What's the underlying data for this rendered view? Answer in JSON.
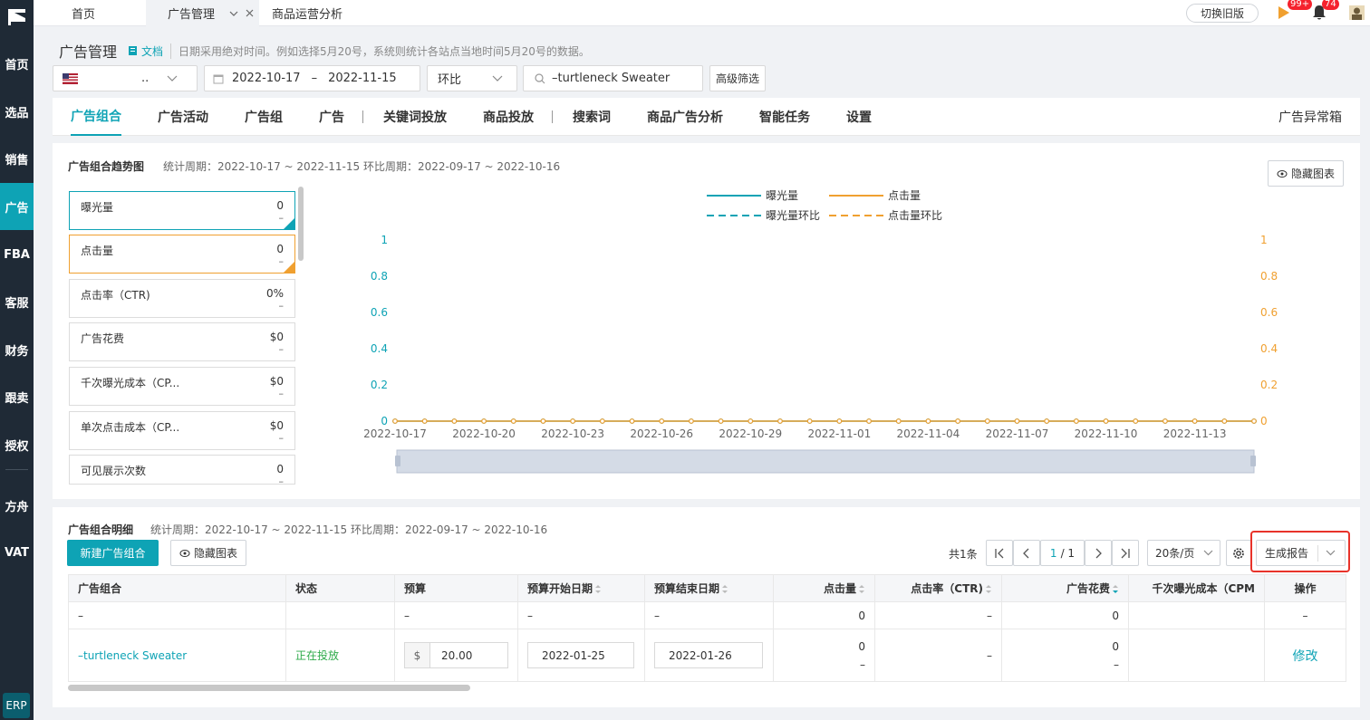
{
  "sidebar": {
    "items": [
      {
        "label": "首页"
      },
      {
        "label": "选品"
      },
      {
        "label": "销售"
      },
      {
        "label": "广告"
      },
      {
        "label": "FBA"
      },
      {
        "label": "客服"
      },
      {
        "label": "财务"
      },
      {
        "label": "跟卖"
      },
      {
        "label": "授权"
      },
      {
        "label": "方舟"
      },
      {
        "label": "VAT"
      }
    ],
    "erp": "ERP"
  },
  "topbar": {
    "tabs": [
      {
        "label": "首页"
      },
      {
        "label": "广告管理"
      },
      {
        "label": "商品运营分析"
      }
    ],
    "switch_old": "切换旧版",
    "badge1": "99+",
    "badge2": "74"
  },
  "header": {
    "title": "广告管理",
    "doc": "文档",
    "hint": "日期采用绝对时间。例如选择5月20号，系统则统计各站点当地时间5月20号的数据。"
  },
  "filters": {
    "store_suffix": "..",
    "date_start": "2022-10-17",
    "date_sep": "–",
    "date_end": "2022-11-15",
    "compare": "环比",
    "search_value": "–turtleneck Sweater",
    "advanced": "高级筛选"
  },
  "nav": {
    "items": [
      {
        "label": "广告组合"
      },
      {
        "label": "广告活动"
      },
      {
        "label": "广告组"
      },
      {
        "label": "广告"
      },
      {
        "label": "关键词投放"
      },
      {
        "label": "商品投放"
      },
      {
        "label": "搜索词"
      },
      {
        "label": "商品广告分析"
      },
      {
        "label": "智能任务"
      },
      {
        "label": "设置"
      }
    ],
    "right": "广告异常箱"
  },
  "trend": {
    "title": "广告组合趋势图",
    "period": "统计周期：2022-10-17 ~ 2022-11-15 环比周期：2022-09-17 ~ 2022-10-16",
    "hide_chart": "隐藏图表",
    "metrics": [
      {
        "label": "曝光量",
        "value": "0",
        "sub": "–"
      },
      {
        "label": "点击量",
        "value": "0",
        "sub": "–"
      },
      {
        "label": "点击率（CTR)",
        "value": "0%",
        "sub": "–"
      },
      {
        "label": "广告花费",
        "value": "$0",
        "sub": "–"
      },
      {
        "label": "千次曝光成本（CP...",
        "value": "$0",
        "sub": "–"
      },
      {
        "label": "单次点击成本（CP...",
        "value": "$0",
        "sub": "–"
      },
      {
        "label": "可见展示次数",
        "value": "0",
        "sub": "–"
      }
    ]
  },
  "chart_data": {
    "type": "line",
    "x": [
      "2022-10-17",
      "2022-10-18",
      "2022-10-19",
      "2022-10-20",
      "2022-10-21",
      "2022-10-22",
      "2022-10-23",
      "2022-10-24",
      "2022-10-25",
      "2022-10-26",
      "2022-10-27",
      "2022-10-28",
      "2022-10-29",
      "2022-10-30",
      "2022-10-31",
      "2022-11-01",
      "2022-11-02",
      "2022-11-03",
      "2022-11-04",
      "2022-11-05",
      "2022-11-06",
      "2022-11-07",
      "2022-11-08",
      "2022-11-09",
      "2022-11-10",
      "2022-11-11",
      "2022-11-12",
      "2022-11-13",
      "2022-11-14",
      "2022-11-15"
    ],
    "x_ticks": [
      "2022-10-17",
      "2022-10-20",
      "2022-10-23",
      "2022-10-26",
      "2022-10-29",
      "2022-11-01",
      "2022-11-04",
      "2022-11-07",
      "2022-11-10",
      "2022-11-13"
    ],
    "series": [
      {
        "name": "曝光量",
        "color": "#0ea3b5",
        "style": "solid",
        "values": [
          0,
          0,
          0,
          0,
          0,
          0,
          0,
          0,
          0,
          0,
          0,
          0,
          0,
          0,
          0,
          0,
          0,
          0,
          0,
          0,
          0,
          0,
          0,
          0,
          0,
          0,
          0,
          0,
          0,
          0
        ]
      },
      {
        "name": "点击量",
        "color": "#f0a030",
        "style": "solid",
        "values": [
          0,
          0,
          0,
          0,
          0,
          0,
          0,
          0,
          0,
          0,
          0,
          0,
          0,
          0,
          0,
          0,
          0,
          0,
          0,
          0,
          0,
          0,
          0,
          0,
          0,
          0,
          0,
          0,
          0,
          0
        ]
      },
      {
        "name": "曝光量环比",
        "color": "#0ea3b5",
        "style": "dashed",
        "values": []
      },
      {
        "name": "点击量环比",
        "color": "#f0a030",
        "style": "dashed",
        "values": []
      }
    ],
    "y_left_ticks": [
      "1",
      "0.8",
      "0.6",
      "0.4",
      "0.2",
      "0"
    ],
    "y_right_ticks": [
      "1",
      "0.8",
      "0.6",
      "0.4",
      "0.2",
      "0"
    ],
    "ylim": [
      0,
      1
    ],
    "legend_position": "top-center",
    "grid": false
  },
  "detail": {
    "title": "广告组合明细",
    "period": "统计周期：2022-10-17 ~ 2022-11-15 环比周期：2022-09-17 ~ 2022-10-16",
    "new_btn": "新建广告组合",
    "hide_chart": "隐藏图表",
    "total": "共1条",
    "page_current": "1",
    "page_total": "/ 1",
    "page_size": "20条/页",
    "report": "生成报告",
    "columns": [
      "广告组合",
      "状态",
      "预算",
      "预算开始日期",
      "预算结束日期",
      "点击量",
      "点击率（CTR)",
      "广告花费",
      "千次曝光成本（CPM",
      "操作"
    ],
    "summary": [
      "–",
      "",
      "–",
      "–",
      "–",
      "0",
      "–",
      "0",
      "",
      "–"
    ],
    "row": {
      "name": "–turtleneck Sweater",
      "status": "正在投放",
      "currency": "$",
      "budget": "20.00",
      "start": "2022-01-25",
      "end": "2022-01-26",
      "clicks": "0",
      "clicks_sub": "–",
      "ctr": "–",
      "spend": "0",
      "spend_sub": "–",
      "action": "修改"
    }
  }
}
